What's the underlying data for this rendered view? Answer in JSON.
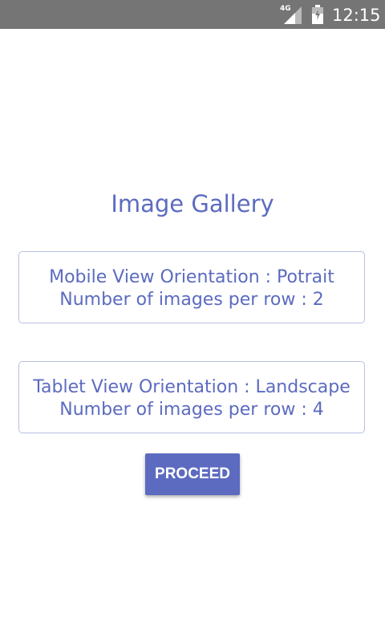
{
  "status_bar": {
    "network": "4G",
    "time": "12:15",
    "signal_icon": "signal-icon",
    "battery_icon": "battery-icon",
    "background_color": "#757575"
  },
  "main": {
    "title": "Image Gallery",
    "accent_color": "#5c6bc0",
    "cards": [
      {
        "orientation_line": "Mobile View Orientation : Potrait",
        "images_line": "Number of images per row : 2"
      },
      {
        "orientation_line": "Tablet View Orientation : Landscape",
        "images_line": "Number of images per row : 4"
      }
    ],
    "proceed_label": "PROCEED"
  }
}
